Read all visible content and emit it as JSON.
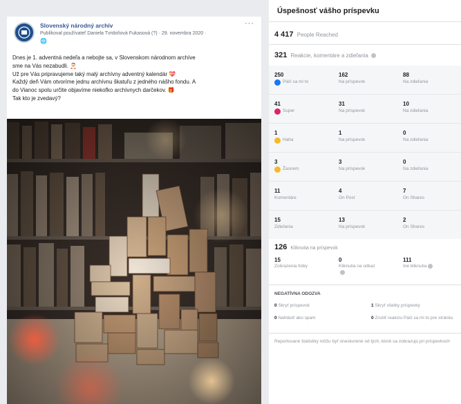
{
  "post": {
    "page_name": "Slovenský národný archív",
    "meta": "Publikoval používateľ Daniela Tvrdoňová Fukasová (?) · 29. novembra 2020 ·",
    "globe_icon": "globe-icon",
    "text_lines": [
      "Dnes je 1. adventná nedeľa a nebojte sa, v Slovenskom národnom archíve",
      "sme na Vás nezabudli. 🎅",
      "Už pre Vás pripravujeme taký malý archívny adventný kalendár 💝",
      "Každý deň Vám otvoríme jednu archívnu škatuľu z jedného nášho fondu. A",
      "do Vianoc spolu určite objavíme niekoľko archívnych darčekov. 🎁",
      "Tak kto je zvedavý?"
    ]
  },
  "insights": {
    "title": "Úspešnosť vášho príspevku",
    "people_reached": {
      "value": "4 417",
      "label": "People Reached"
    },
    "reactions": {
      "value": "321",
      "label": "Reakcie, komentáre a zdieľania"
    },
    "grid": [
      [
        {
          "num": "250",
          "label": "Páči sa mi to",
          "icon": "like"
        },
        {
          "num": "162",
          "label": "Na príspevok"
        },
        {
          "num": "88",
          "label": "Na zdieľania"
        }
      ],
      [
        {
          "num": "41",
          "label": "Super",
          "icon": "love"
        },
        {
          "num": "31",
          "label": "Na príspevok"
        },
        {
          "num": "10",
          "label": "Na zdieľania"
        }
      ],
      [
        {
          "num": "1",
          "label": "Haha",
          "icon": "haha"
        },
        {
          "num": "1",
          "label": "Na príspevok"
        },
        {
          "num": "0",
          "label": "Na zdieľania"
        }
      ],
      [
        {
          "num": "3",
          "label": "Žasnem",
          "icon": "wow"
        },
        {
          "num": "3",
          "label": "Na príspevok"
        },
        {
          "num": "0",
          "label": "Na zdieľania"
        }
      ],
      [
        {
          "num": "11",
          "label": "Komentáre"
        },
        {
          "num": "4",
          "label": "On Post"
        },
        {
          "num": "7",
          "label": "On Shares"
        }
      ],
      [
        {
          "num": "15",
          "label": "Zdieľania"
        },
        {
          "num": "13",
          "label": "Na príspevok"
        },
        {
          "num": "2",
          "label": "On Shares"
        }
      ]
    ],
    "clicks": {
      "value": "126",
      "label": "Kliknutia na príspevok",
      "items": [
        {
          "num": "15",
          "label": "Zobrazenia fotky"
        },
        {
          "num": "0",
          "label": "Kliknutia na odkaz"
        },
        {
          "num": "111",
          "label": "Iné kliknutia"
        }
      ]
    },
    "negative": {
      "title": "NEGATÍVNA ODOZVA",
      "items": [
        {
          "num": "0",
          "label": "Skryť príspevok"
        },
        {
          "num": "1",
          "label": "Skryť všetky príspevky"
        },
        {
          "num": "0",
          "label": "Nahlásiť ako spam"
        },
        {
          "num": "0",
          "label": "Zrušiť reakciu Páči sa mi to pre stránku"
        }
      ]
    },
    "footnote": "Reportované štatistiky môžu byť oneskorené od tých, ktoré sa zobrazujú pri príspevkoch"
  }
}
